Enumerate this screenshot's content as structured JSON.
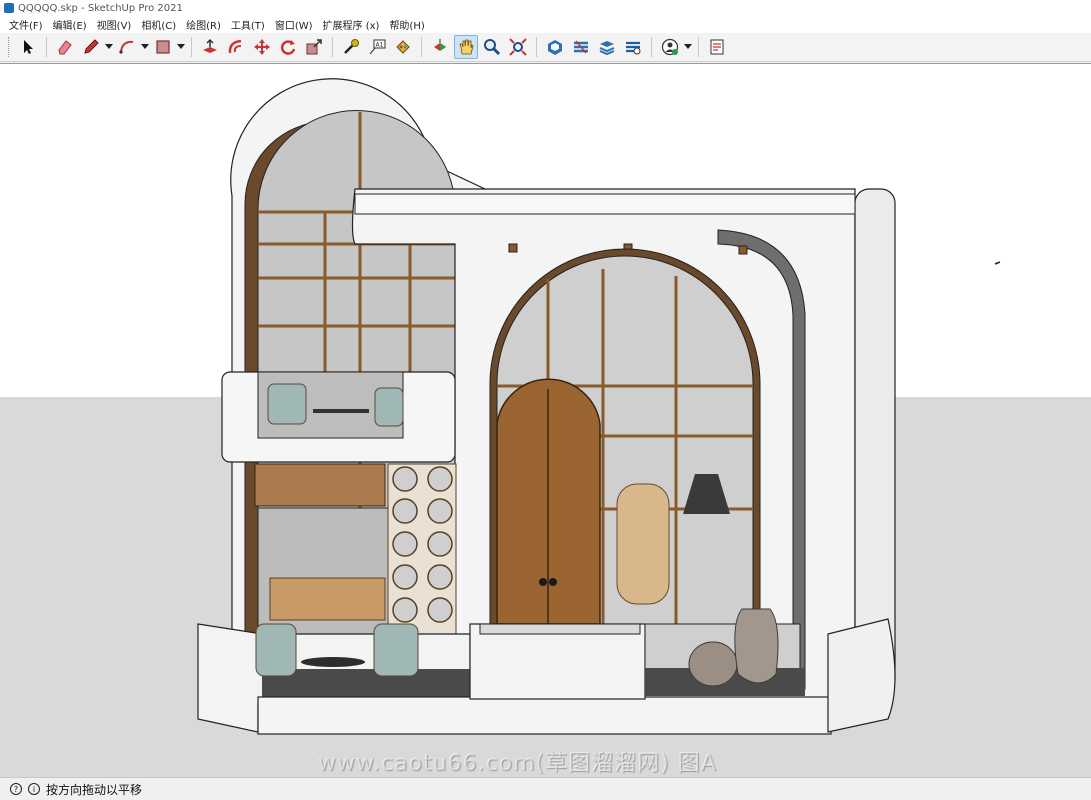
{
  "window": {
    "title": "QQQQQ.skp - SketchUp Pro 2021"
  },
  "menu": [
    {
      "id": "file",
      "label": "文件(F)"
    },
    {
      "id": "edit",
      "label": "编辑(E)"
    },
    {
      "id": "view",
      "label": "视图(V)"
    },
    {
      "id": "camera",
      "label": "相机(C)"
    },
    {
      "id": "draw",
      "label": "绘图(R)"
    },
    {
      "id": "tools",
      "label": "工具(T)"
    },
    {
      "id": "window",
      "label": "窗口(W)"
    },
    {
      "id": "extensions",
      "label": "扩展程序 (x)"
    },
    {
      "id": "help",
      "label": "帮助(H)"
    }
  ],
  "toolbar": {
    "tools": [
      "select-icon",
      "eraser-icon",
      "pencil-icon",
      "arc-icon",
      "rectangle-icon",
      "push-pull-icon",
      "offset-icon",
      "move-icon",
      "rotate-icon",
      "scale-icon",
      "tape-measure-icon",
      "text-icon",
      "paint-bucket-icon",
      "orbit-icon",
      "pan-icon",
      "zoom-icon",
      "zoom-extents-icon",
      "warehouse-icon",
      "extension-warehouse-icon",
      "layout-icon",
      "extension-manager-icon",
      "profile-icon",
      "report-icon"
    ],
    "active_tool": "pan-icon"
  },
  "status": {
    "hint": "按方向拖动以平移"
  },
  "watermark": "www.caotu66.com(草图溜溜网) 图A",
  "colors": {
    "sky": "#ffffff",
    "ground": "#d9d9d9",
    "wall": "#f4f4f4",
    "wood": "#8b5a2b",
    "glass": "#b9b9b9"
  }
}
